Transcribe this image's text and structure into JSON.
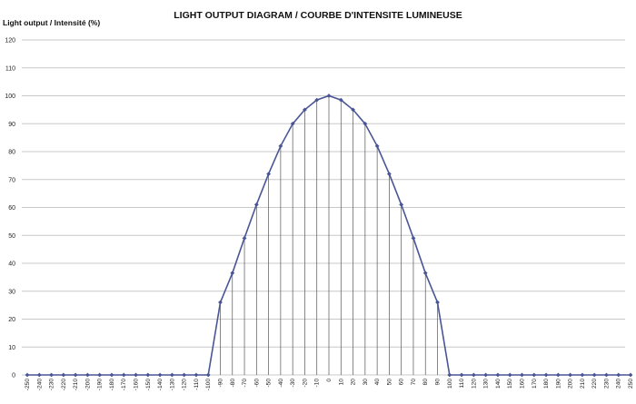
{
  "chart_data": {
    "type": "line",
    "title": "LIGHT OUTPUT DIAGRAM / COURBE D'INTENSITE LUMINEUSE",
    "ylabel": "Light output / Intensité (%)",
    "xlabel": "",
    "ylim": [
      0,
      120
    ],
    "y_ticks": [
      0,
      10,
      20,
      30,
      40,
      50,
      60,
      70,
      80,
      90,
      100,
      110,
      120
    ],
    "x": [
      -250,
      -240,
      -230,
      -220,
      -210,
      -200,
      -190,
      -180,
      -170,
      -160,
      -150,
      -140,
      -130,
      -120,
      -110,
      -100,
      -90,
      -80,
      -70,
      -60,
      -50,
      -40,
      -30,
      -20,
      -10,
      0,
      10,
      20,
      30,
      40,
      50,
      60,
      70,
      80,
      90,
      100,
      110,
      120,
      130,
      140,
      150,
      160,
      170,
      180,
      190,
      200,
      210,
      220,
      230,
      240,
      250
    ],
    "values": [
      0,
      0,
      0,
      0,
      0,
      0,
      0,
      0,
      0,
      0,
      0,
      0,
      0,
      0,
      0,
      0,
      26,
      36.5,
      49,
      61,
      72,
      82,
      90,
      95,
      98.5,
      100,
      98.5,
      95,
      90,
      82,
      72,
      61,
      49,
      36.5,
      26,
      0,
      0,
      0,
      0,
      0,
      0,
      0,
      0,
      0,
      0,
      0,
      0,
      0,
      0,
      0,
      0
    ],
    "grid": "horizontal",
    "drop_lines": true,
    "legend": "none",
    "line_color": "#4a5596",
    "marker_color": "#4a5596"
  }
}
